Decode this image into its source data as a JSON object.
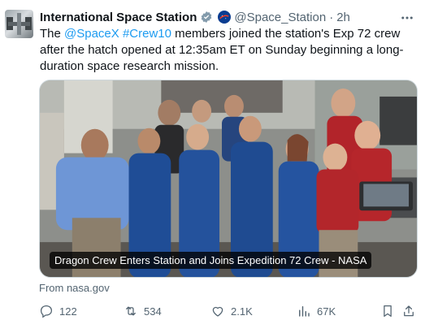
{
  "tweet": {
    "author_name": "International Space Station",
    "handle": "@Space_Station",
    "separator": "·",
    "time": "2h",
    "text_part1": "The ",
    "mention": "@SpaceX",
    "space": " ",
    "hashtag": "#Crew10",
    "text_part2": " members joined the station's Exp 72 crew after the hatch opened at 12:35am ET on Sunday beginning a long-duration space research mission."
  },
  "media": {
    "caption": "Dragon Crew Enters Station and Joins Expedition 72 Crew - NASA",
    "source": "From nasa.gov"
  },
  "actions": {
    "replies": "122",
    "reposts": "534",
    "likes": "2.1K",
    "views": "67K"
  },
  "colors": {
    "accent": "#1d9bf0",
    "muted": "#536471",
    "text": "#0f1419"
  },
  "icons": [
    "verified-badge-icon",
    "nasa-logo-icon",
    "more-options-icon",
    "reply-icon",
    "repost-icon",
    "like-icon",
    "views-icon",
    "bookmark-icon",
    "share-icon"
  ]
}
